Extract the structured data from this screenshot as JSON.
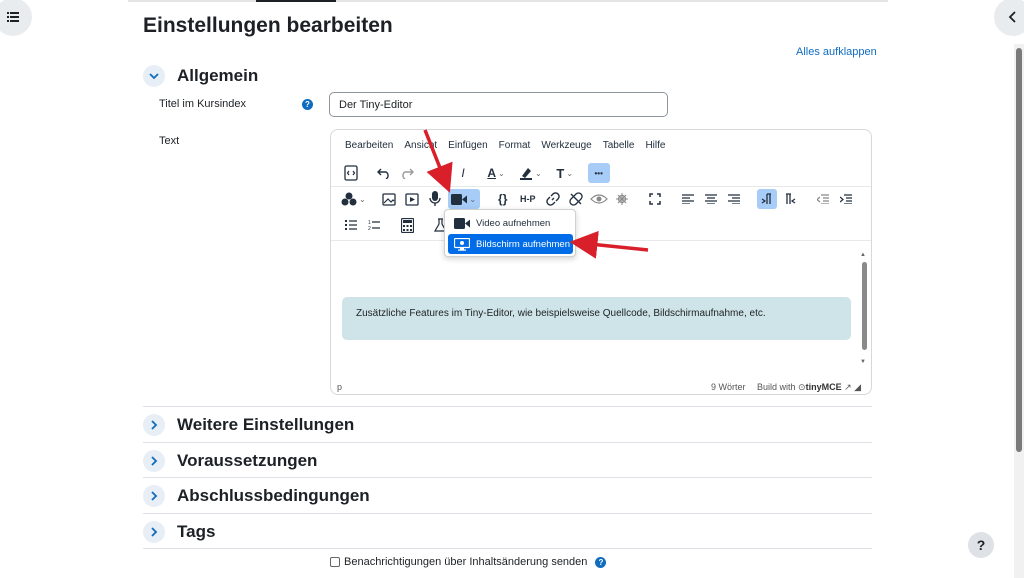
{
  "page": {
    "title": "Einstellungen bearbeiten",
    "expand_all": "Alles aufklappen"
  },
  "sections": {
    "general": "Allgemein",
    "more": "Weitere Einstellungen",
    "restrictions": "Voraussetzungen",
    "completion": "Abschlussbedingungen",
    "tags": "Tags"
  },
  "form": {
    "title_label": "Titel im Kursindex",
    "title_value": "Der Tiny-Editor",
    "text_label": "Text",
    "notify_label": "Benachrichtigungen über Inhaltsänderung senden"
  },
  "editor": {
    "menu": [
      "Bearbeiten",
      "Ansicht",
      "Einfügen",
      "Format",
      "Werkzeuge",
      "Tabelle",
      "Hilfe"
    ],
    "content_note": "Zusätzliche Features im Tiny-Editor, wie beispielsweise Quellcode, Bildschirmaufnahme, etc.",
    "status_path": "p",
    "word_count": "9 Wörter",
    "build_with": "Build with",
    "brand": "tinyMCE",
    "dropdown": {
      "video": "Video aufnehmen",
      "screen": "Bildschirm aufnehmen"
    },
    "toolbar_glyphs": {
      "bold": "B",
      "italic": "I",
      "font_color": "A",
      "font_size": "T",
      "more": "•••",
      "code_braces": "{}",
      "h5p": "H-P"
    }
  },
  "help_glyph": "?",
  "colors": {
    "accent": "#0f6cbf",
    "selected": "#006ce7",
    "active_button": "#a6ccf7",
    "note_bg": "#cfe4e8",
    "annotation_arrow": "#d9202a"
  }
}
